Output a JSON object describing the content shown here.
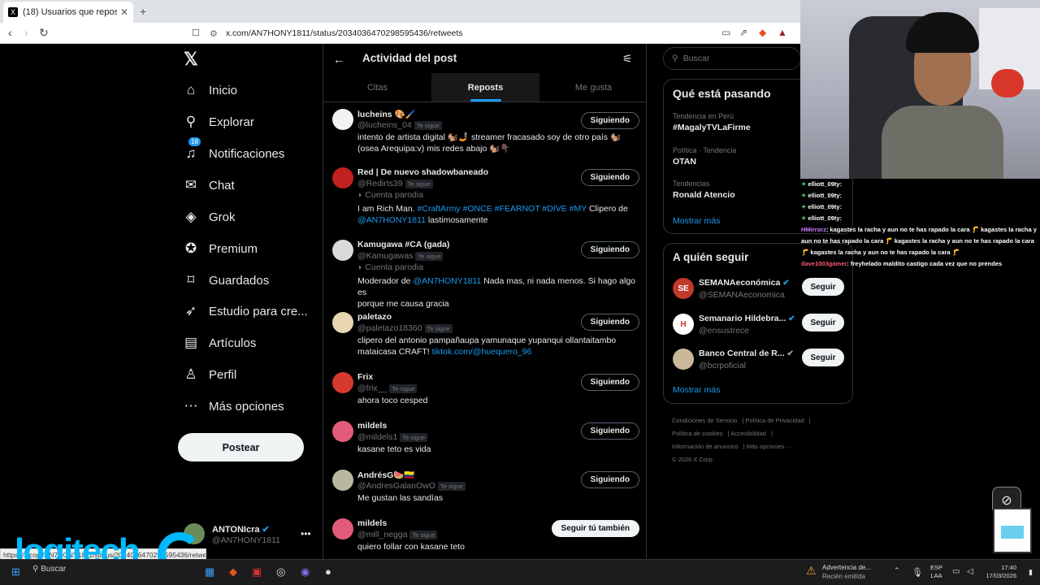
{
  "browser": {
    "tab_title": "(18) Usuarios que repostearon e",
    "url": "x.com/AN7HONY1811/status/2034036470298595436/retweets",
    "status_url": "https://x.com/AN7HONY1811/status/2034036470298595436/retweets"
  },
  "nav": {
    "items": [
      {
        "label": "Inicio",
        "icon": "home-icon"
      },
      {
        "label": "Explorar",
        "icon": "search-icon"
      },
      {
        "label": "Notificaciones",
        "icon": "bell-icon",
        "badge": "18"
      },
      {
        "label": "Chat",
        "icon": "mail-icon"
      },
      {
        "label": "Grok",
        "icon": "grok-icon"
      },
      {
        "label": "Premium",
        "icon": "verified-icon"
      },
      {
        "label": "Guardados",
        "icon": "bookmark-icon"
      },
      {
        "label": "Estudio para cre...",
        "icon": "rocket-icon"
      },
      {
        "label": "Artículos",
        "icon": "article-icon"
      },
      {
        "label": "Perfil",
        "icon": "person-icon"
      },
      {
        "label": "Más opciones",
        "icon": "more-icon"
      }
    ],
    "post_button": "Postear",
    "account": {
      "name": "ANTONIcra",
      "handle": "@AN7HONY1811"
    }
  },
  "main": {
    "title": "Actividad del post",
    "tabs": [
      "Citas",
      "Reposts",
      "Me gusta"
    ],
    "active_tab": "Reposts",
    "users": [
      {
        "name": "lucheins 🎨🖌️",
        "handle": "@lucheins_04",
        "follows_you": "Te sigue",
        "button": "Siguiendo",
        "avatar_color": "#f2f2f2",
        "bio1": "intento de artista digital 🐿️🤳🏿 streamer fracasado soy de otro país 🐿️",
        "bio2": "(osea Arequipa:v) mis redes abajo 🐿️👇🏿"
      },
      {
        "name": "Red | De nuevo shadowbaneado",
        "handle": "@Redirts39",
        "follows_you": "Te sigue",
        "button": "Siguiendo",
        "avatar_color": "#c2201f",
        "parody": "Cuenta parodia",
        "bio_pre": "I am Rich Man. ",
        "bio_tags": "#CraftArmy #ONCE #FEARNOT #DIVE #MY",
        "bio_mid": " Clipero de",
        "bio_link": "@AN7HONY1811",
        "bio_post": " lastimosamente"
      },
      {
        "name": "Kamugawa #CA (gada)",
        "handle": "@Kamugawas",
        "follows_you": "Te sigue",
        "button": "Siguiendo",
        "avatar_color": "#d9d9d9",
        "parody": "Cuenta parodia",
        "bio_pre": "Moderador de ",
        "bio_link": "@AN7HONY1811",
        "bio_post": " Nada mas, ni nada menos. Si hago algo es",
        "bio2": "porque me causa gracia"
      },
      {
        "name": "paletazo",
        "handle": "@paletazo18360",
        "follows_you": "Te sigue",
        "button": "Siguiendo",
        "avatar_color": "#e8d6b0",
        "bio1": "clipero del antonio pampañaupa yamunaque yupanqui ollantaitambo",
        "bio2_pre": "mataicasa CRAFT! ",
        "bio2_link": "tiktok.com/@huequero_96"
      },
      {
        "name": "Frix",
        "handle": "@frix__",
        "follows_you": "Te sigue",
        "button": "Siguiendo",
        "avatar_color": "#d63a2e",
        "bio1": "ahora toco cesped"
      },
      {
        "name": "mildels",
        "handle": "@mildels1",
        "follows_you": "Te sigue",
        "button": "Siguiendo",
        "avatar_color": "#e25c7a",
        "bio1": "kasane teto es vida"
      },
      {
        "name": "AndrésG🍉🇨🇴",
        "handle": "@AndresGalanOwO",
        "follows_you": "Te sigue",
        "button": "Siguiendo",
        "avatar_color": "#b8b8a0",
        "bio1": "Me gustan las sandías"
      },
      {
        "name": "mildels",
        "handle": "@mill_negga",
        "follows_you": "Te sigue",
        "button": "Seguir tú también",
        "avatar_color": "#e25c7a",
        "bio1": "quiero follar con kasane teto"
      }
    ]
  },
  "right": {
    "search_placeholder": "Buscar",
    "trends_title": "Qué está pasando",
    "trends": [
      {
        "context": "Tendencia en Perú",
        "name": "#MagalyTVLaFirme"
      },
      {
        "context": "Política · Tendencia",
        "name": "OTAN"
      },
      {
        "context": "Tendencias",
        "name": "Ronald Atencio"
      }
    ],
    "show_more": "Mostrar más",
    "wtf_title": "A quién seguir",
    "wtf": [
      {
        "name": "SEMANAeconómica",
        "handle": "@SEMANAeconomica",
        "button": "Seguir",
        "avatar_color": "#c0392b",
        "avatar_text": "SE",
        "badge": "✔"
      },
      {
        "name": "Semanario Hildebra...",
        "handle": "@ensustrece",
        "button": "Seguir",
        "avatar_color": "#ffffff",
        "avatar_text": "H",
        "badge": "✔"
      },
      {
        "name": "Banco Central de R...",
        "handle": "@bcrpoficial",
        "button": "Seguir",
        "avatar_color": "#cbb89a",
        "avatar_text": "",
        "badge": "✔"
      }
    ],
    "footer": [
      "Condiciones de Servicio",
      "Política de Privacidad",
      "Política de cookies",
      "Accesibilidad",
      "Información de anuncios",
      "Más opciones ···",
      "© 2026 X Corp."
    ]
  },
  "overlay": {
    "chat": [
      {
        "user": "elliott_09ty",
        "msg": ":"
      },
      {
        "user": "elliott_09ty",
        "msg": ":"
      },
      {
        "user": "elliott_09ty",
        "msg": ":"
      },
      {
        "user": "elliott_09ty",
        "msg": ":"
      },
      {
        "user": "HMirrorz",
        "msg": ": kagastes la racha y aun no te has rapado la cara 🦵 kagastes la racha y aun no te has rapado la cara 🦵 kagastes la racha y aun no te has rapado la cara 🦵 kagastes la racha y aun no te has rapado la cara 🦵"
      },
      {
        "user": "dave1003gamer",
        "msg": ": freyhelado maldito castigo cada vez que no prendes"
      }
    ],
    "brand": "logitech"
  },
  "taskbar": {
    "search": "Buscar",
    "warning_title": "Advertencia de...",
    "warning_sub": "Recién emitida",
    "lang1": "ESP",
    "lang2": "LAA",
    "time": "17:40",
    "date": "17/03/2026"
  }
}
